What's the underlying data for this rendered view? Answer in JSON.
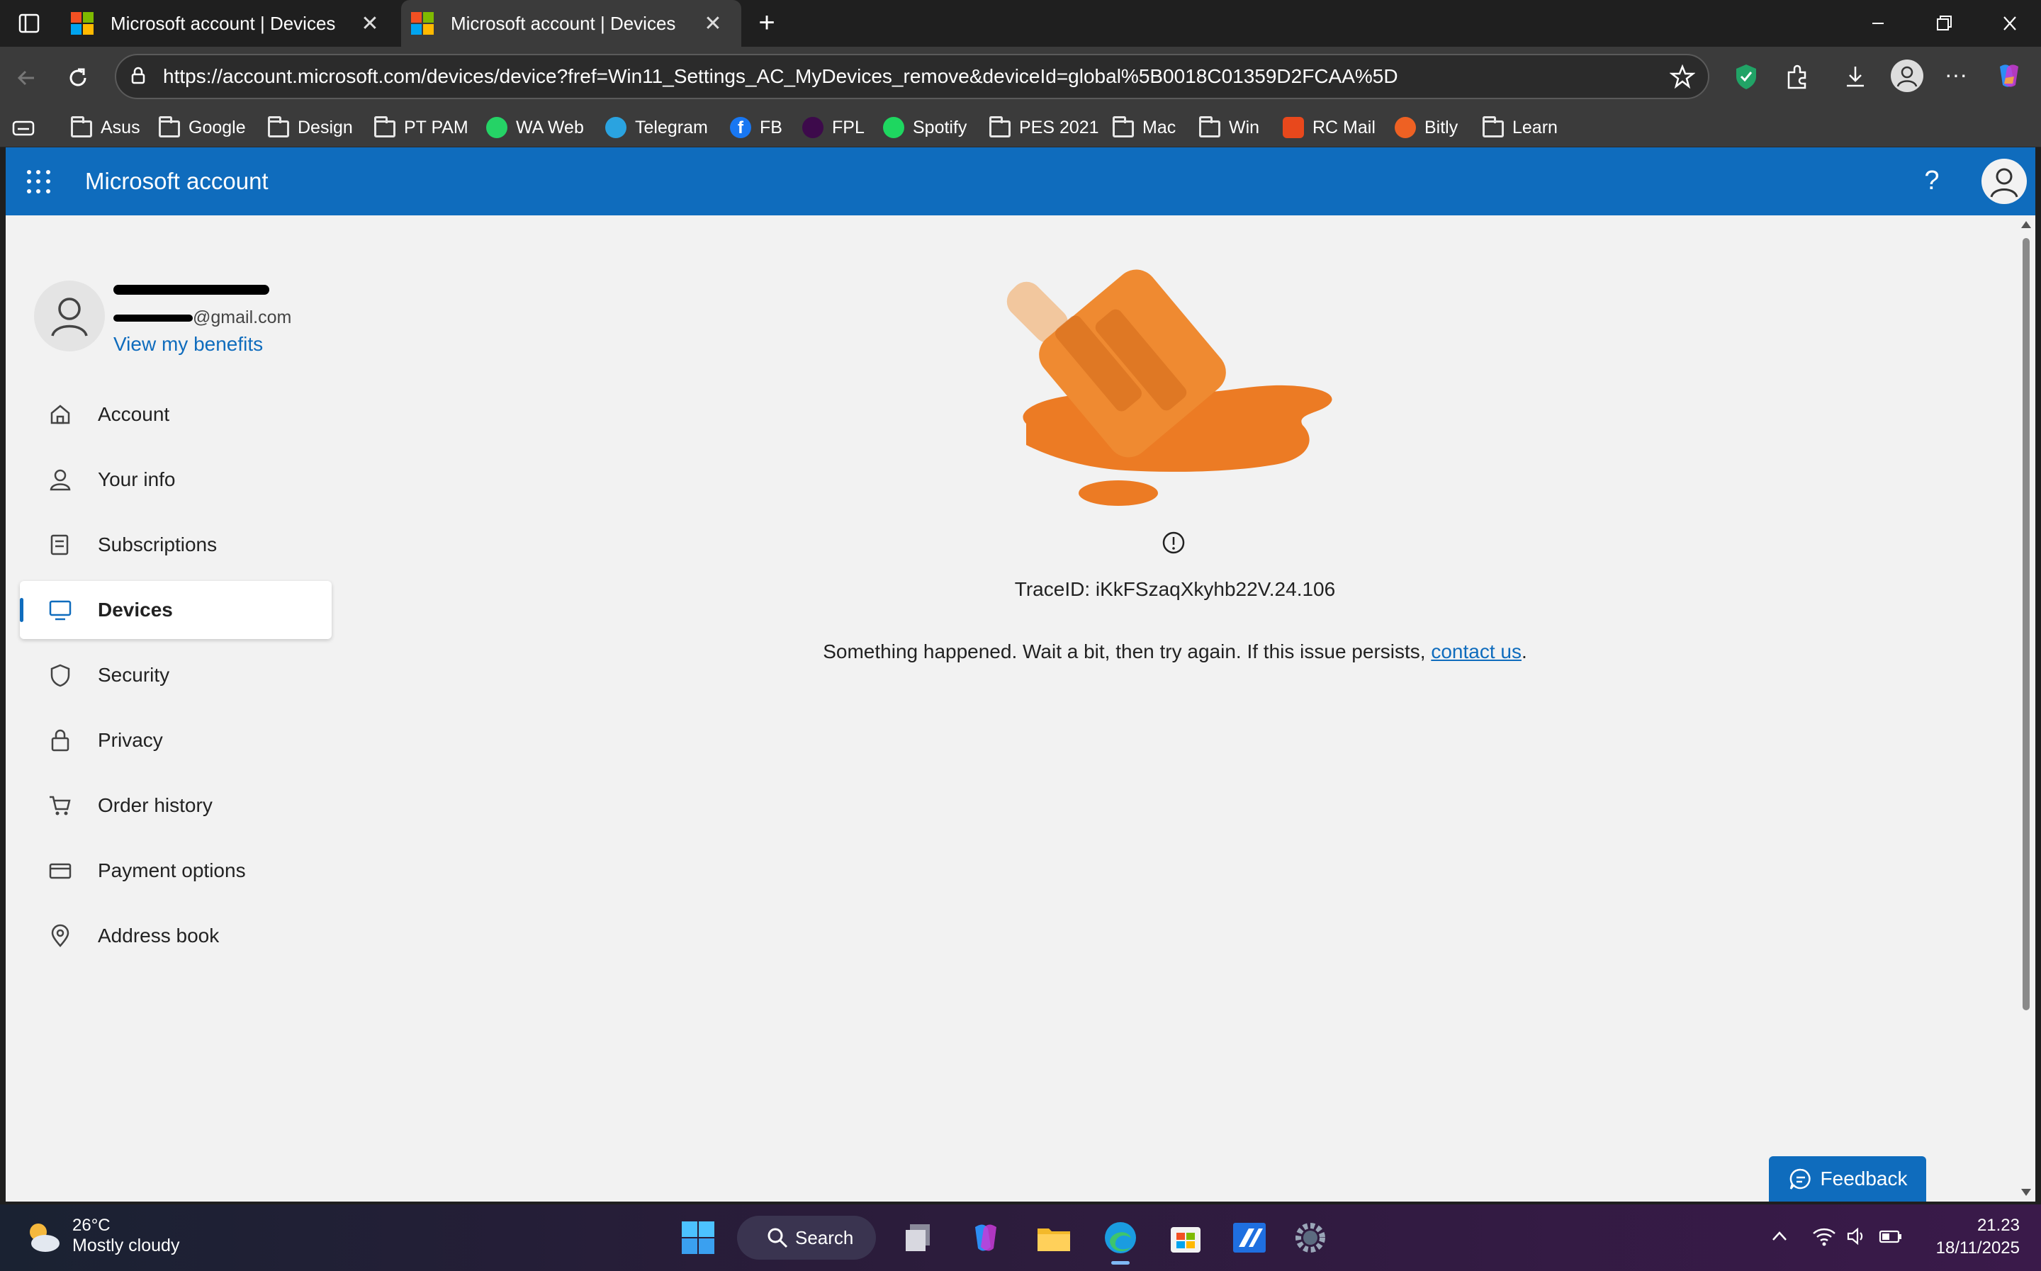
{
  "browser": {
    "tabs": [
      {
        "title": "Microsoft account | Devices",
        "active": false
      },
      {
        "title": "Microsoft account | Devices",
        "active": true
      }
    ],
    "url": "https://account.microsoft.com/devices/device?fref=Win11_Settings_AC_MyDevices_remove&deviceId=global%5B0018C01359D2FCAA%5D",
    "bookmarks": [
      {
        "label": "Asus",
        "icon": "folder-icon"
      },
      {
        "label": "Google",
        "icon": "folder-icon"
      },
      {
        "label": "Design",
        "icon": "folder-icon"
      },
      {
        "label": "PT PAM",
        "icon": "folder-icon"
      },
      {
        "label": "WA Web",
        "icon": "whatsapp-icon"
      },
      {
        "label": "Telegram",
        "icon": "telegram-icon"
      },
      {
        "label": "FB",
        "icon": "facebook-icon"
      },
      {
        "label": "FPL",
        "icon": "premier-league-icon"
      },
      {
        "label": "Spotify",
        "icon": "spotify-icon"
      },
      {
        "label": "PES 2021",
        "icon": "folder-icon"
      },
      {
        "label": "Mac",
        "icon": "folder-icon"
      },
      {
        "label": "Win",
        "icon": "folder-icon"
      },
      {
        "label": "RC Mail",
        "icon": "mail-icon"
      },
      {
        "label": "Bitly",
        "icon": "bitly-icon"
      },
      {
        "label": "Learn",
        "icon": "folder-icon"
      }
    ]
  },
  "header": {
    "brand": "Microsoft account",
    "help": "?"
  },
  "profile": {
    "email_suffix": "@gmail.com",
    "benefits_link": "View my benefits"
  },
  "sidebar": {
    "items": [
      {
        "label": "Account",
        "icon": "home-icon",
        "active": false
      },
      {
        "label": "Your info",
        "icon": "person-icon",
        "active": false
      },
      {
        "label": "Subscriptions",
        "icon": "subscriptions-icon",
        "active": false
      },
      {
        "label": "Devices",
        "icon": "laptop-icon",
        "active": true
      },
      {
        "label": "Security",
        "icon": "shield-icon",
        "active": false
      },
      {
        "label": "Privacy",
        "icon": "lock-icon",
        "active": false
      },
      {
        "label": "Order history",
        "icon": "cart-icon",
        "active": false
      },
      {
        "label": "Payment options",
        "icon": "card-icon",
        "active": false
      },
      {
        "label": "Address book",
        "icon": "location-icon",
        "active": false
      }
    ]
  },
  "error": {
    "trace": "TraceID: iKkFSzaqXkyhb22V.24.106",
    "message": "Something happened. Wait a bit, then try again. If this issue persists, ",
    "link": "contact us",
    "end": "."
  },
  "feedback": "Feedback",
  "taskbar": {
    "temperature": "26°C",
    "weather": "Mostly cloudy",
    "search": "Search",
    "time": "21.23",
    "date": "18/11/2025"
  },
  "colors": {
    "accent": "#0f6cbd",
    "popsicle": "#ec7b24",
    "chrome": "#3b3b3b"
  }
}
